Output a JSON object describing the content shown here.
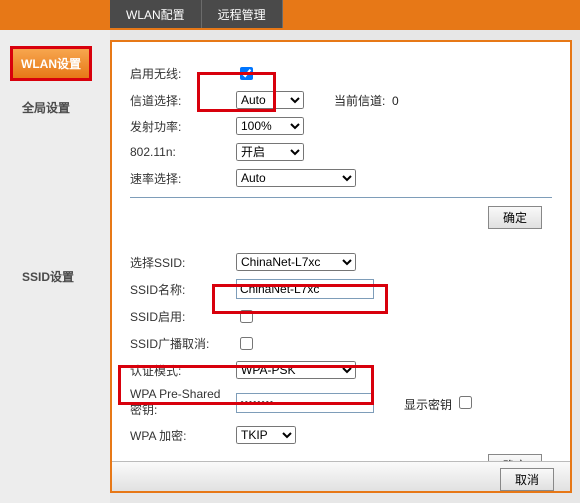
{
  "tabs": {
    "wlan": "WLAN配置",
    "remote": "远程管理"
  },
  "sidebar": {
    "head": "WLAN设置",
    "global": "全局设置",
    "ssid": "SSID设置"
  },
  "global": {
    "enable_wifi_label": "启用无线:",
    "channel_label": "信道选择:",
    "channel_value": "Auto",
    "current_channel_label": "当前信道:",
    "current_channel_value": "0",
    "tx_power_label": "发射功率:",
    "tx_power_value": "100%",
    "mode_label": "802.11n:",
    "mode_value": "开启",
    "rate_label": "速率选择:",
    "rate_value": "Auto",
    "confirm": "确定"
  },
  "ssid": {
    "select_label": "选择SSID:",
    "select_value": "ChinaNet-L7xc",
    "name_label": "SSID名称:",
    "name_value": "ChinaNet-L7xc",
    "enable_label": "SSID启用:",
    "broadcast_label": "SSID广播取消:",
    "auth_label": "认证模式:",
    "auth_value": "WPA-PSK",
    "psk_label": "WPA Pre-Shared 密钥:",
    "psk_value": "••••••••",
    "show_key_label": "显示密钥",
    "encrypt_label": "WPA 加密:",
    "encrypt_value": "TKIP",
    "confirm": "确定"
  },
  "footer": {
    "cancel": "取消"
  }
}
